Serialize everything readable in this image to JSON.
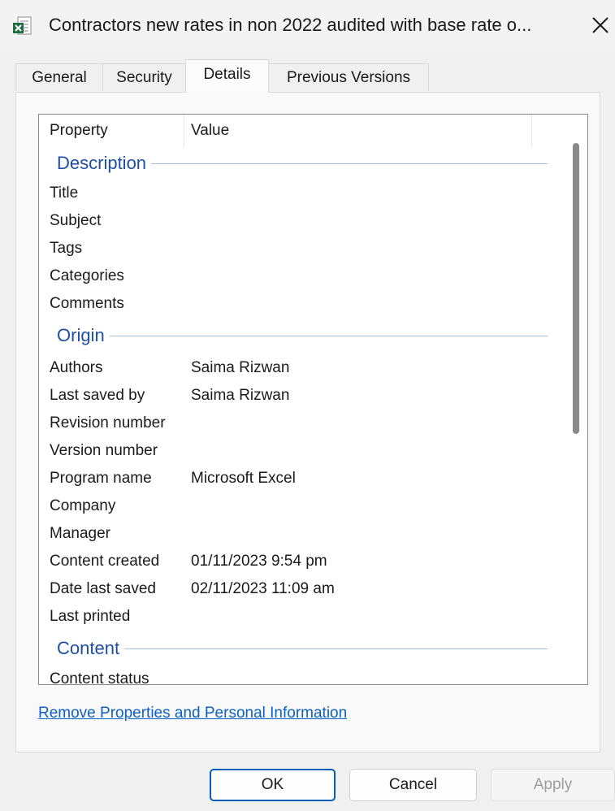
{
  "window": {
    "title": "Contractors new rates in non 2022 audited with base rate o...",
    "icon": "excel-file-icon",
    "close_icon": "close-icon"
  },
  "tabs": [
    {
      "label": "General",
      "active": false
    },
    {
      "label": "Security",
      "active": false
    },
    {
      "label": "Details",
      "active": true
    },
    {
      "label": "Previous Versions",
      "active": false
    }
  ],
  "list": {
    "columns": {
      "property": "Property",
      "value": "Value"
    },
    "groups": [
      {
        "label": "Description",
        "rows": [
          {
            "name": "Title",
            "value": ""
          },
          {
            "name": "Subject",
            "value": ""
          },
          {
            "name": "Tags",
            "value": ""
          },
          {
            "name": "Categories",
            "value": ""
          },
          {
            "name": "Comments",
            "value": ""
          }
        ]
      },
      {
        "label": "Origin",
        "rows": [
          {
            "name": "Authors",
            "value": "Saima Rizwan"
          },
          {
            "name": "Last saved by",
            "value": "Saima Rizwan"
          },
          {
            "name": "Revision number",
            "value": ""
          },
          {
            "name": "Version number",
            "value": ""
          },
          {
            "name": "Program name",
            "value": "Microsoft Excel"
          },
          {
            "name": "Company",
            "value": ""
          },
          {
            "name": "Manager",
            "value": ""
          },
          {
            "name": "Content created",
            "value": "01/11/2023 9:54 pm"
          },
          {
            "name": "Date last saved",
            "value": "02/11/2023 11:09 am"
          },
          {
            "name": "Last printed",
            "value": ""
          }
        ]
      },
      {
        "label": "Content",
        "rows": [
          {
            "name": "Content status",
            "value": ""
          }
        ]
      }
    ]
  },
  "link": {
    "label": "Remove Properties and Personal Information"
  },
  "buttons": {
    "ok": "OK",
    "cancel": "Cancel",
    "apply": "Apply",
    "apply_enabled": false
  },
  "colors": {
    "group_label": "#1f4ea8",
    "link": "#0b61c4",
    "accent": "#005fb8"
  }
}
